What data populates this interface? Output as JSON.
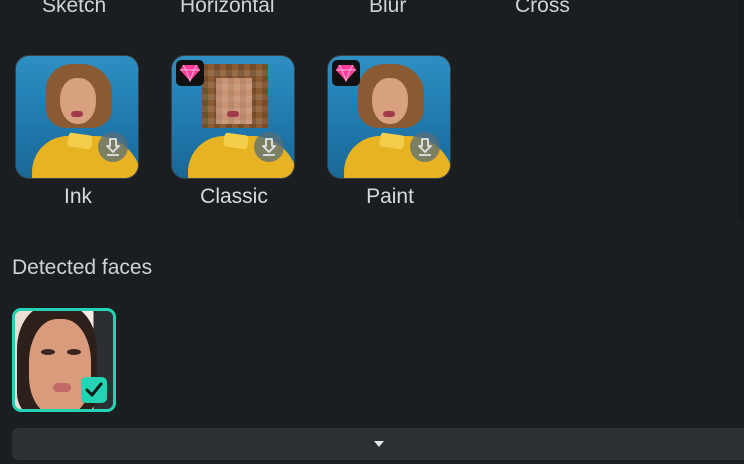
{
  "top_row": {
    "labels": [
      "Sketch",
      "Horizontal",
      "Blur",
      "Cross"
    ]
  },
  "effects": [
    {
      "label": "Ink",
      "premium": false,
      "download_icon": "download-icon"
    },
    {
      "label": "Classic",
      "premium": true,
      "download_icon": "download-icon"
    },
    {
      "label": "Paint",
      "premium": true,
      "download_icon": "download-icon"
    }
  ],
  "detected_faces": {
    "title": "Detected faces",
    "faces": [
      {
        "selected": true
      }
    ]
  },
  "colors": {
    "background": "#1b1e21",
    "accent": "#24d3b3",
    "premium_gem": "#ff3e9b"
  },
  "footer": {
    "expand_icon": "caret-down-icon"
  }
}
